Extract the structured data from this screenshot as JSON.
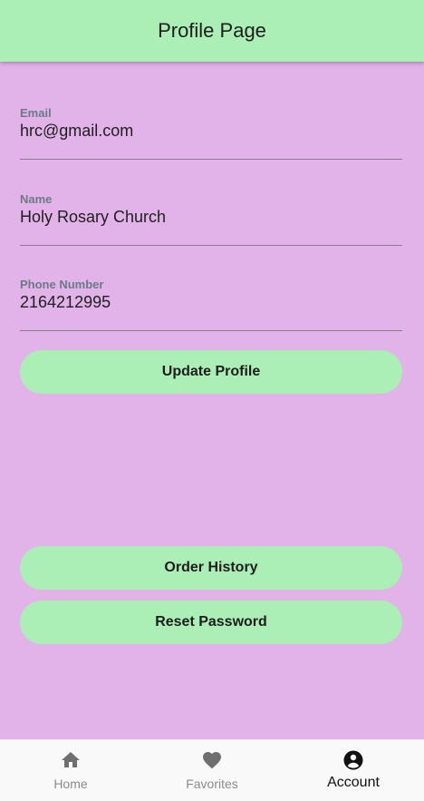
{
  "app_bar": {
    "title": "Profile Page"
  },
  "form": {
    "email": {
      "label": "Email",
      "value": "hrc@gmail.com"
    },
    "name": {
      "label": "Name",
      "value": "Holy Rosary Church"
    },
    "phone": {
      "label": "Phone Number",
      "value": "2164212995"
    }
  },
  "buttons": {
    "update_profile": "Update Profile",
    "order_history": "Order History",
    "reset_password": "Reset Password"
  },
  "bottom_nav": {
    "items": [
      {
        "label": "Home",
        "icon": "home-icon",
        "active": false
      },
      {
        "label": "Favorites",
        "icon": "heart-icon",
        "active": false
      },
      {
        "label": "Account",
        "icon": "account-circle-icon",
        "active": true
      }
    ]
  },
  "colors": {
    "background": "#e2b3e9",
    "accent": "#abefb6",
    "label": "#6c7a86",
    "nav_inactive": "#8a8a8a",
    "nav_active": "#111111"
  }
}
